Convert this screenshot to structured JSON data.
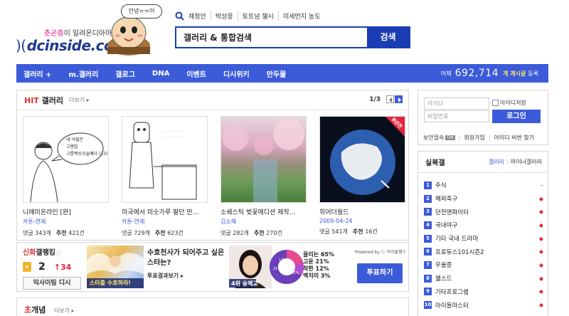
{
  "header": {
    "logo_tagline_pink": "춘곤증",
    "logo_tagline_rest": "이 밀려온디아아아",
    "logo_text": "dcinside.com",
    "bubble_text": "안녕ㅠㅠ어",
    "hot_keywords": [
      "채정안",
      "박성웅",
      "토트넘 챌시",
      "미세먼지 농도"
    ],
    "search_value": "갤러리 & 통합검색",
    "search_button": "검색"
  },
  "nav": {
    "items": [
      "갤러리 +",
      "m.갤러리",
      "갤로그",
      "DNA",
      "이벤트",
      "디시위키",
      "만두몰"
    ],
    "yesterday_label": "어제",
    "count": "692,714",
    "unit": "개 게시글",
    "unit2": "등록"
  },
  "hit": {
    "title_red": "HIT",
    "title_rest": " 갤러리",
    "more": "더보기 ▸",
    "page": "1/3",
    "cards": [
      {
        "title": "니애미온라인 [완]",
        "author": "카툰-연재",
        "comments_label": "댓글",
        "comments": "343개",
        "rec_label": "추천",
        "rec": "421건",
        "bubble_lines": [
          "내 어릴은",
          "고봉밥",
          "고릉백수모솔예다 (23)"
        ]
      },
      {
        "title": "미국에서 미숫가루 팔던 만…",
        "author": "카툰-연재",
        "comments_label": "댓글",
        "comments": "729개",
        "rec_label": "추천",
        "rec": "623건"
      },
      {
        "title": "소쉐스틱 벚꽃에디션 제작…",
        "author": "김소혜",
        "comments_label": "댓글",
        "comments": "282개",
        "rec_label": "추천",
        "rec": "270건"
      },
      {
        "title": "위어더월드",
        "author": "2009-04-24",
        "comments_label": "댓글",
        "comments": "541개",
        "rec_label": "추천",
        "rec": "16건",
        "badge": "8년전"
      }
    ]
  },
  "ranking": {
    "title_red": "신화",
    "title_rest": "갤랭킹",
    "info": "ⓘ",
    "rank": "2",
    "change": "↑34",
    "button": "익사이팅 디시",
    "question": "수호천사가 되어주고 싶은 스타는?",
    "sub": "투표결과보기 ▸",
    "img1_caption": "스타를 수호하라!",
    "img2_caption": "4위 송혜교",
    "poll": [
      "끌리는 65%",
      "고운 21%",
      "착한 12%",
      "백치미 3%"
    ],
    "donut_labels": [
      "12%",
      "21%",
      "65%"
    ],
    "powered": "Powered by ⓒ 아이돌챔스",
    "vote_button": "투표하기",
    "colors": {
      "a": "#e84a8f",
      "b": "#b44fd1",
      "c": "#6b3fb8",
      "d": "#ffb347"
    }
  },
  "concept": {
    "title_red": "초",
    "title_rest": "개념",
    "more": "더보기 ▸"
  },
  "login": {
    "id_placeholder": "아이디",
    "pw_placeholder": "비밀번호",
    "save_label": "아이디저장",
    "button": "로그인",
    "security": "보안접속",
    "security_badge": "ON",
    "join": "회원가입",
    "find": "아이디 비번 찾기"
  },
  "realtime": {
    "title": "실북갤",
    "tab_active": "갤러리",
    "tab_other": "마이너갤러리",
    "items": [
      {
        "n": "1",
        "name": "주식",
        "trend": "flat"
      },
      {
        "n": "2",
        "name": "해외축구",
        "trend": "up"
      },
      {
        "n": "3",
        "name": "던전앤파이터",
        "trend": "up"
      },
      {
        "n": "4",
        "name": "국내야구",
        "trend": "up"
      },
      {
        "n": "5",
        "name": "기타 국내 드라마",
        "trend": "up"
      },
      {
        "n": "6",
        "name": "프로듀스101시즌2",
        "trend": "up"
      },
      {
        "n": "7",
        "name": "우울증",
        "trend": "up"
      },
      {
        "n": "8",
        "name": "웰스드",
        "trend": "up"
      },
      {
        "n": "9",
        "name": "기타프로그램",
        "trend": "up"
      },
      {
        "n": "10",
        "name": "아이돌마스터",
        "trend": "up"
      }
    ],
    "flat_symbol": "–",
    "up_symbol": "◆"
  }
}
